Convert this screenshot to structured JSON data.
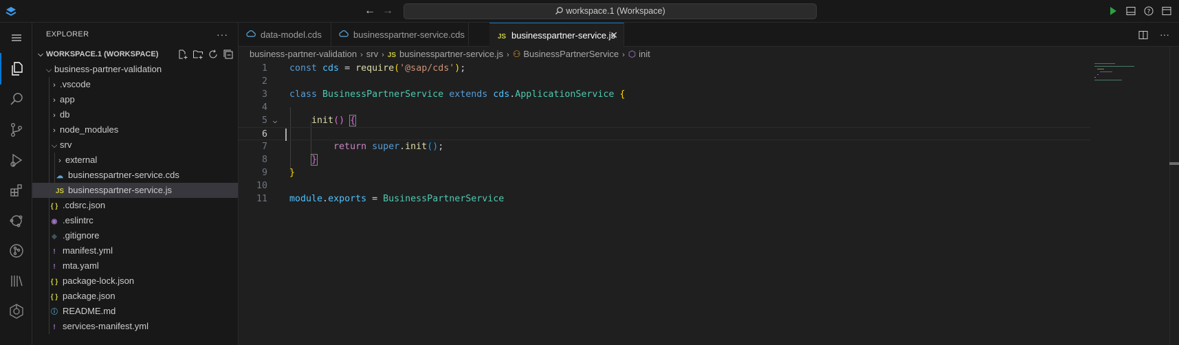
{
  "window": {
    "command_center": "workspace.1 (Workspace)",
    "back_icon": "arrow-left-icon",
    "forward_icon": "arrow-right-icon"
  },
  "activity_bar": {
    "items": [
      {
        "name": "menu-icon"
      },
      {
        "name": "explorer-icon"
      },
      {
        "name": "search-icon"
      },
      {
        "name": "source-control-icon"
      },
      {
        "name": "run-debug-icon"
      },
      {
        "name": "extensions-icon"
      },
      {
        "name": "remote-explorer-icon"
      },
      {
        "name": "git-graph-icon"
      },
      {
        "name": "library-icon"
      },
      {
        "name": "cds-graph-icon"
      }
    ]
  },
  "sidebar": {
    "title": "EXPLORER",
    "more": "···",
    "workspace_label": "WORKSPACE.1 (WORKSPACE)",
    "tree": [
      {
        "label": "business-partner-validation",
        "type": "folder-open",
        "depth": 1
      },
      {
        "label": ".vscode",
        "type": "folder",
        "depth": 2
      },
      {
        "label": "app",
        "type": "folder",
        "depth": 2
      },
      {
        "label": "db",
        "type": "folder",
        "depth": 2
      },
      {
        "label": "node_modules",
        "type": "folder",
        "depth": 2
      },
      {
        "label": "srv",
        "type": "folder-open",
        "depth": 2
      },
      {
        "label": "external",
        "type": "folder",
        "depth": 3
      },
      {
        "label": "businesspartner-service.cds",
        "type": "cds",
        "depth": 3
      },
      {
        "label": "businesspartner-service.js",
        "type": "js",
        "depth": 3,
        "selected": true
      },
      {
        "label": ".cdsrc.json",
        "type": "json",
        "depth": 2
      },
      {
        "label": ".eslintrc",
        "type": "eslint",
        "depth": 2
      },
      {
        "label": ".gitignore",
        "type": "git",
        "depth": 2
      },
      {
        "label": "manifest.yml",
        "type": "yml",
        "depth": 2
      },
      {
        "label": "mta.yaml",
        "type": "yml",
        "depth": 2
      },
      {
        "label": "package-lock.json",
        "type": "json",
        "depth": 2
      },
      {
        "label": "package.json",
        "type": "json",
        "depth": 2
      },
      {
        "label": "README.md",
        "type": "info",
        "depth": 2
      },
      {
        "label": "services-manifest.yml",
        "type": "yml",
        "depth": 2
      }
    ]
  },
  "tabs": [
    {
      "label": "data-model.cds",
      "icon": "cds"
    },
    {
      "label": "businesspartner-service.cds",
      "icon": "cds"
    },
    {
      "label": "businesspartner-service.js",
      "icon": "js",
      "active": true
    }
  ],
  "icon_text": {
    "js": "JS",
    "json": "{ }",
    "yml": "!"
  },
  "breadcrumb": {
    "items": [
      "business-partner-validation",
      "srv",
      "businesspartner-service.js",
      "BusinessPartnerService",
      "init"
    ],
    "separator": ">"
  },
  "code": {
    "line_numbers": [
      "1",
      "2",
      "3",
      "4",
      "5",
      "6",
      "7",
      "8",
      "9",
      "10",
      "11"
    ],
    "current_line": "6"
  },
  "colors": {
    "accent": "#0078d4",
    "keyword": "#569cd6",
    "control": "#c586c0",
    "class": "#4ec9b0",
    "string": "#ce9178",
    "function": "#dcdcaa",
    "js_icon": "#cbcb41"
  }
}
